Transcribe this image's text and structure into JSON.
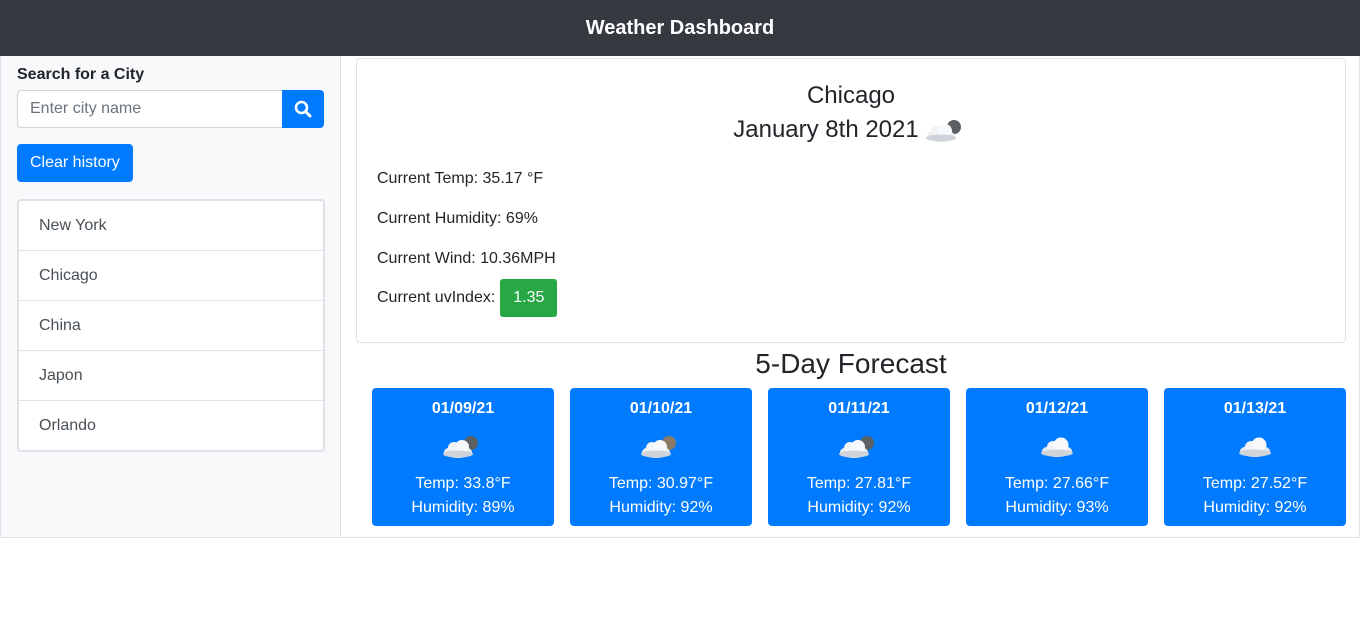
{
  "header": {
    "title": "Weather Dashboard"
  },
  "sidebar": {
    "search_label": "Search for a City",
    "search_placeholder": "Enter city name",
    "search_value": "",
    "clear_label": "Clear history",
    "history": [
      "New York",
      "Chicago",
      "China",
      "Japon",
      "Orlando"
    ]
  },
  "current": {
    "city": "Chicago",
    "date": "January 8th 2021",
    "icon": "cloud-moon-icon",
    "temp": "Current Temp: 35.17 °F",
    "humidity": "Current Humidity: 69%",
    "wind": "Current Wind: 10.36MPH",
    "uv_label": "Current uvIndex:",
    "uv_value": "1.35",
    "uv_color": "#28a745"
  },
  "forecast": {
    "title": "5-Day Forecast",
    "days": [
      {
        "date": "01/09/21",
        "icon": "cloud-moon-icon",
        "temp": "Temp: 33.8°F",
        "humidity": "Humidity: 89%"
      },
      {
        "date": "01/10/21",
        "icon": "cloud-moon-icon",
        "temp": "Temp: 30.97°F",
        "humidity": "Humidity: 92%"
      },
      {
        "date": "01/11/21",
        "icon": "cloud-moon-icon",
        "temp": "Temp: 27.81°F",
        "humidity": "Humidity: 92%"
      },
      {
        "date": "01/12/21",
        "icon": "cloud-icon",
        "temp": "Temp: 27.66°F",
        "humidity": "Humidity: 93%"
      },
      {
        "date": "01/13/21",
        "icon": "cloud-icon",
        "temp": "Temp: 27.52°F",
        "humidity": "Humidity: 92%"
      }
    ]
  },
  "colors": {
    "primary": "#007bff",
    "header_bg": "#343a40",
    "success": "#28a745"
  }
}
